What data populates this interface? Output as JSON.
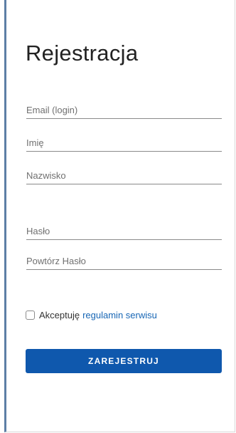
{
  "form": {
    "title": "Rejestracja",
    "fields": {
      "email": {
        "placeholder": "Email (login)",
        "value": ""
      },
      "first_name": {
        "placeholder": "Imię",
        "value": ""
      },
      "last_name": {
        "placeholder": "Nazwisko",
        "value": ""
      },
      "password": {
        "placeholder": "Hasło",
        "value": ""
      },
      "password_repeat": {
        "placeholder": "Powtórz Hasło",
        "value": ""
      }
    },
    "terms": {
      "checked": false,
      "label": "Akceptuję",
      "link_text": "regulamin serwisu"
    },
    "submit_label": "ZAREJESTRUJ"
  },
  "colors": {
    "accent": "#0f58ad",
    "link": "#1766b5",
    "border_left": "#5d7fa6"
  }
}
